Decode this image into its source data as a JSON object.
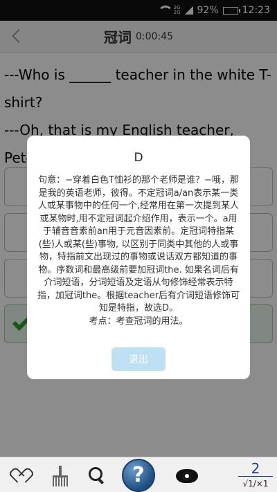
{
  "status_bar": {
    "net_top": "3G",
    "net_bottom": "2G",
    "battery": "92%",
    "time": "12:23"
  },
  "header": {
    "title": "冠词",
    "timer": "0:00:45"
  },
  "question": {
    "line1": "---Who is ______ teacher in the white T-",
    "line2": "shirt?",
    "line3": "---Oh, that is my English teacher, Peter."
  },
  "modal": {
    "answer": "D",
    "explanation": "句意：−穿着白色T恤衫的那个老师是谁？−哦，那是我的英语老师，彼得。不定冠词a/an表示某一类人或某事物中的任何一个,经常用在第一次提到某人或某物时,用不定冠词起介绍作用，表示一个。a用于辅音音素前an用于元音因素前。定冠词特指某(些)人或某(些)事物, 以区别于同类中其他的人或事物，特指前文出现过的事物或说话双方都知道的事物。序数词和最高级前要加冠词the. 如果名词后有介词短语，分词短语及定语从句修饰经常表示特指，加冠词the。根据teacher后有介词短语修饰可知是特指，故选D。",
    "point": "考点：考查冠词的用法。",
    "exit_label": "退出"
  },
  "toolbar": {
    "icons": [
      "heart-icon",
      "broom-icon",
      "search-icon",
      "help-icon",
      "eye-icon"
    ],
    "help_glyph": "?",
    "page_current": "2",
    "page_total": "√1/×1"
  },
  "colors": {
    "correct_check": "#27a22b",
    "exit_button": "#bde0f3",
    "page_link": "#1a3ea8"
  }
}
